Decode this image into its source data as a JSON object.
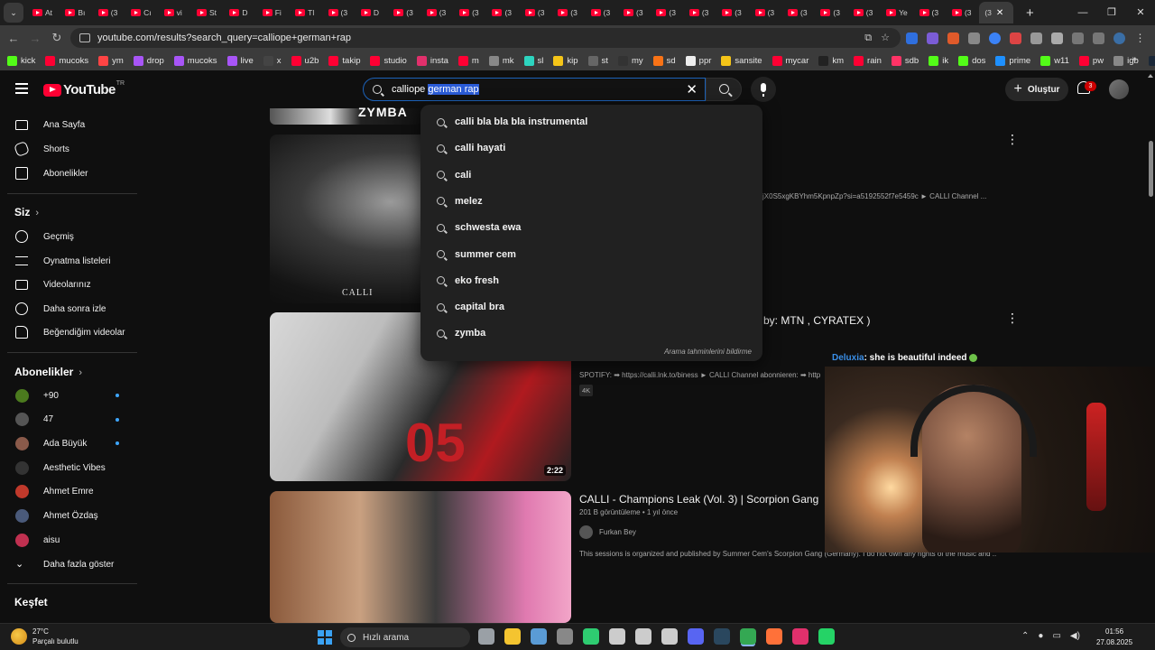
{
  "browser": {
    "tabs": [
      "At",
      "Bı",
      "(3",
      "Cı",
      "vi",
      "St",
      "D",
      "Fi",
      "Tl",
      "(3",
      "D",
      "(3",
      "(3",
      "(3",
      "(3",
      "(3",
      "(3",
      "(3",
      "(3",
      "(3",
      "(3",
      "(3",
      "(3",
      "(3",
      "(3",
      "(3",
      "Ye",
      "(3",
      "(3"
    ],
    "active_tab": "(3",
    "url": "youtube.com/results?search_query=calliope+german+rap",
    "bookmarks": [
      {
        "label": "kick",
        "color": "#53fc18"
      },
      {
        "label": "mucoks",
        "color": "#ff0033"
      },
      {
        "label": "ym",
        "color": "#ff4444"
      },
      {
        "label": "drop",
        "color": "#a855f7"
      },
      {
        "label": "mucoks",
        "color": "#a855f7"
      },
      {
        "label": "live",
        "color": "#a855f7"
      },
      {
        "label": "x",
        "color": "#444444"
      },
      {
        "label": "u2b",
        "color": "#ff0033"
      },
      {
        "label": "takip",
        "color": "#ff0033"
      },
      {
        "label": "studio",
        "color": "#ff0033"
      },
      {
        "label": "insta",
        "color": "#e1306c"
      },
      {
        "label": "m",
        "color": "#ff0033"
      },
      {
        "label": "mk",
        "color": "#888888"
      },
      {
        "label": "sl",
        "color": "#2dd4bf"
      },
      {
        "label": "kip",
        "color": "#f5c518"
      },
      {
        "label": "st",
        "color": "#666666"
      },
      {
        "label": "my",
        "color": "#333333"
      },
      {
        "label": "sd",
        "color": "#f97316"
      },
      {
        "label": "ppr",
        "color": "#eeeeee"
      },
      {
        "label": "sansite",
        "color": "#f5c518"
      },
      {
        "label": "mycar",
        "color": "#ff0033"
      },
      {
        "label": "km",
        "color": "#222222"
      },
      {
        "label": "rain",
        "color": "#ff0033"
      },
      {
        "label": "sdb",
        "color": "#ff3366"
      },
      {
        "label": "ik",
        "color": "#53fc18"
      },
      {
        "label": "dos",
        "color": "#53fc18"
      },
      {
        "label": "prime",
        "color": "#1e90ff"
      },
      {
        "label": "w11",
        "color": "#53fc18"
      },
      {
        "label": "pw",
        "color": "#ff0033"
      },
      {
        "label": "igb",
        "color": "#888888"
      },
      {
        "label": "steam",
        "color": "#1b2838"
      }
    ]
  },
  "youtube": {
    "logo_text": "YouTube",
    "logo_region": "TR",
    "search": {
      "typed": "calliope ",
      "selected": "german rap"
    },
    "create_label": "Oluştur",
    "notification_count": "3",
    "suggestions": [
      "calli bla bla bla instrumental",
      "calli hayati",
      "cali",
      "melez",
      "schwesta ewa",
      "summer cem",
      "eko fresh",
      "capital bra",
      "zymba"
    ],
    "suggestions_report": "Arama tahminlerini bildirme"
  },
  "sidebar": {
    "main": [
      "Ana Sayfa",
      "Shorts",
      "Abonelikler"
    ],
    "you_title": "Siz",
    "you_items": [
      "Geçmiş",
      "Oynatma listeleri",
      "Videolarınız",
      "Daha sonra izle",
      "Beğendiğim videolar"
    ],
    "subs_title": "Abonelikler",
    "subs": [
      {
        "name": "+90",
        "dot": true,
        "color": "#4b7a1e"
      },
      {
        "name": "47",
        "dot": true,
        "color": "#555555"
      },
      {
        "name": "Ada Büyük",
        "dot": true,
        "color": "#8a5a4a"
      },
      {
        "name": "Aesthetic Vibes",
        "dot": false,
        "color": "#333333"
      },
      {
        "name": "Ahmet Emre",
        "dot": false,
        "color": "#c0392b"
      },
      {
        "name": "Ahmet Özdaş",
        "dot": false,
        "color": "#4a5a7a"
      },
      {
        "name": "aisu",
        "dot": false,
        "color": "#c03050"
      }
    ],
    "show_more": "Daha fazla göster",
    "explore_title": "Keşfet"
  },
  "results": {
    "top_thumb_text": "ZYMBA",
    "video1": {
      "thumb_text": "CALLI",
      "desc": "jX0S5xgKBYhm5KpnpZp?si=a5192552f7e5459c ► CALLI Channel ..."
    },
    "video2": {
      "title_tail": "by: MTN , CYRATEX )",
      "desc": "SPOTIFY: ➡ https://calli.lnk.to/biness ► CALLI Channel abonnieren: ➡ http",
      "quality": "4K",
      "duration": "2:22"
    },
    "video3": {
      "title": "CALLI - Champions Leak (Vol. 3) | Scorpion Gang",
      "meta": "201 B görüntüleme • 1 yıl önce",
      "channel": "Furkan Bey",
      "desc": "This sessions is organized and published by Summer Cem's Scorpion Gang (Germany). I do not own any rights of the music and ..."
    }
  },
  "stream_chat": {
    "user": "Deluxia",
    "message": ": she is beautiful indeed"
  },
  "taskbar": {
    "temp": "27°C",
    "weather": "Parçalı bulutlu",
    "search": "Hızlı arama",
    "time": "01:56",
    "date": "27.08.2025",
    "apps": [
      {
        "name": "task-view",
        "color": "#9aa0a6"
      },
      {
        "name": "file-explorer",
        "color": "#f4c430"
      },
      {
        "name": "store",
        "color": "#5a9bd5"
      },
      {
        "name": "settings",
        "color": "#888888"
      },
      {
        "name": "headset-app",
        "color": "#2ecc71"
      },
      {
        "name": "app-6",
        "color": "#cccccc"
      },
      {
        "name": "app-7",
        "color": "#cccccc"
      },
      {
        "name": "app-8",
        "color": "#cccccc"
      },
      {
        "name": "discord",
        "color": "#5865f2"
      },
      {
        "name": "steam",
        "color": "#2a475e"
      },
      {
        "name": "chrome",
        "color": "#34a853"
      },
      {
        "name": "firefox",
        "color": "#ff7139"
      },
      {
        "name": "instagram",
        "color": "#e1306c"
      },
      {
        "name": "whatsapp",
        "color": "#25d366"
      }
    ]
  }
}
